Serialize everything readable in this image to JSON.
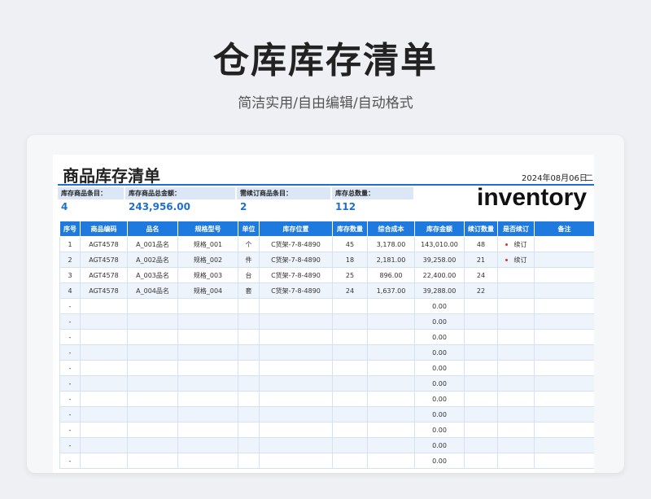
{
  "hero": {
    "title": "仓库库存清单",
    "subtitle": "简洁实用/自由编辑/自动格式"
  },
  "sheet": {
    "title": "商品库存清单",
    "date": "2024年08月06日",
    "weekday": "二",
    "inventory_word": "inventory",
    "summary": [
      {
        "label": "库存商品条目：",
        "value": "4"
      },
      {
        "label": "库存商品总金额：",
        "value": "243,956.00"
      },
      {
        "label": "需续订商品条目：",
        "value": "2"
      },
      {
        "label": "库存总数量：",
        "value": "112"
      }
    ],
    "columns": [
      "序号",
      "商品编码",
      "品名",
      "规格型号",
      "单位",
      "库存位置",
      "库存数量",
      "综合成本",
      "库存金额",
      "续订数量",
      "是否续订",
      "备注"
    ],
    "rows": [
      [
        "1",
        "AGT4578",
        "A_001品名",
        "规格_001",
        "个",
        "C货架-7-8-4890",
        "45",
        "3,178.00",
        "143,010.00",
        "48",
        "续订",
        ""
      ],
      [
        "2",
        "AGT4578",
        "A_002品名",
        "规格_002",
        "件",
        "C货架-7-8-4890",
        "18",
        "2,181.00",
        "39,258.00",
        "21",
        "续订",
        ""
      ],
      [
        "3",
        "AGT4578",
        "A_003品名",
        "规格_003",
        "台",
        "C货架-7-8-4890",
        "25",
        "896.00",
        "22,400.00",
        "24",
        "",
        ""
      ],
      [
        "4",
        "AGT4578",
        "A_004品名",
        "规格_004",
        "套",
        "C货架-7-8-4890",
        "24",
        "1,637.00",
        "39,288.00",
        "22",
        "",
        ""
      ],
      [
        "-",
        "",
        "",
        "",
        "",
        "",
        "",
        "",
        "0.00",
        "",
        "",
        ""
      ],
      [
        "-",
        "",
        "",
        "",
        "",
        "",
        "",
        "",
        "0.00",
        "",
        "",
        ""
      ],
      [
        "-",
        "",
        "",
        "",
        "",
        "",
        "",
        "",
        "0.00",
        "",
        "",
        ""
      ],
      [
        "-",
        "",
        "",
        "",
        "",
        "",
        "",
        "",
        "0.00",
        "",
        "",
        ""
      ],
      [
        "-",
        "",
        "",
        "",
        "",
        "",
        "",
        "",
        "0.00",
        "",
        "",
        ""
      ],
      [
        "-",
        "",
        "",
        "",
        "",
        "",
        "",
        "",
        "0.00",
        "",
        "",
        ""
      ],
      [
        "-",
        "",
        "",
        "",
        "",
        "",
        "",
        "",
        "0.00",
        "",
        "",
        ""
      ],
      [
        "-",
        "",
        "",
        "",
        "",
        "",
        "",
        "",
        "0.00",
        "",
        "",
        ""
      ],
      [
        "-",
        "",
        "",
        "",
        "",
        "",
        "",
        "",
        "0.00",
        "",
        "",
        ""
      ],
      [
        "-",
        "",
        "",
        "",
        "",
        "",
        "",
        "",
        "0.00",
        "",
        "",
        ""
      ],
      [
        "-",
        "",
        "",
        "",
        "",
        "",
        "",
        "",
        "0.00",
        "",
        "",
        ""
      ]
    ],
    "colors": {
      "header_blue": "#1f7ae0",
      "value_blue": "#1f6fd1",
      "status_red": "#d33"
    }
  }
}
